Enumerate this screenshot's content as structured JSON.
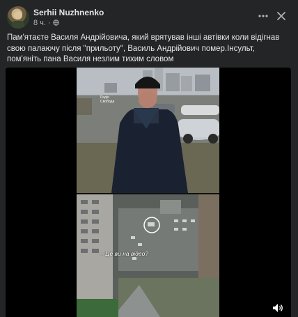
{
  "post": {
    "author": "Serhii Nuzhnenko",
    "time": "8 ч.",
    "separator": "·",
    "privacy_icon": "globe-icon",
    "text": "Пам'ятаєте Василя Андрійовича, який врятував інші автівки коли відігнав свою палаючу після \"прильоту\", Василь Андрійович помер.Інсульт, пом'яніть пана Василя незлим тихим словом"
  },
  "video": {
    "watermark_line1": "Радіо",
    "watermark_line2": "Свобода",
    "caption": "– Це ви на відео?",
    "volume_icon": "volume-icon"
  },
  "colors": {
    "background": "#242526",
    "text_primary": "#e4e6eb",
    "text_secondary": "#b0b3b8"
  }
}
